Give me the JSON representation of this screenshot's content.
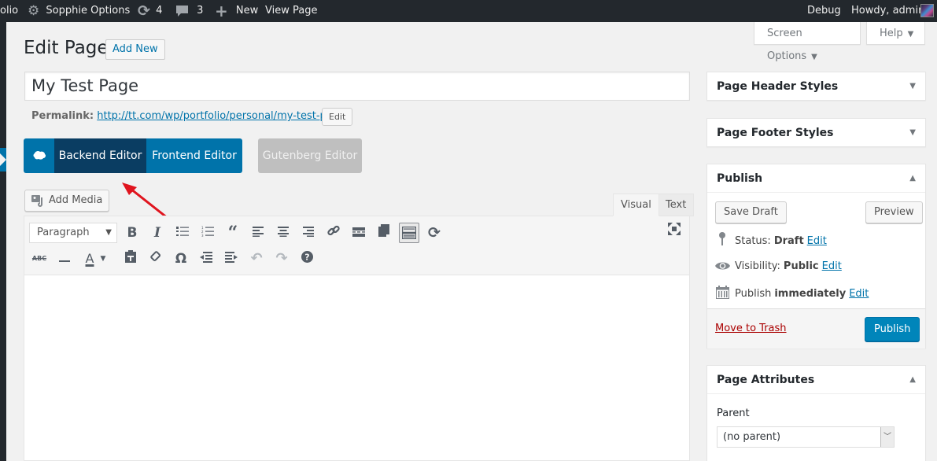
{
  "admin_bar": {
    "site_name_partial": "olio",
    "options_label": "Sopphie Options",
    "updates_count": "4",
    "comments_count": "3",
    "new_label": "New",
    "view_page_label": "View Page",
    "debug_label": "Debug",
    "greeting": "Howdy, admin"
  },
  "screen_meta": {
    "screen_options_label": "Screen Options",
    "help_label": "Help"
  },
  "header": {
    "title": "Edit Page",
    "add_new_label": "Add New"
  },
  "post": {
    "title_value": "My Test Page",
    "permalink_label": "Permalink:",
    "permalink_base": "http://tt.com/wp/portfolio/personal/",
    "permalink_slug": "my-test-page",
    "permalink_trailing": "/",
    "permalink_edit_label": "Edit"
  },
  "editor_switch": {
    "backend_label": "Backend Editor",
    "frontend_label": "Frontend Editor",
    "gutenberg_label": "Gutenberg Editor",
    "active": "Backend Editor"
  },
  "editor": {
    "add_media_label": "Add Media",
    "tabs": [
      {
        "label": "Visual",
        "active": true
      },
      {
        "label": "Text",
        "active": false
      }
    ],
    "format_select_value": "Paragraph",
    "toolbar_row1": [
      "bold",
      "italic",
      "bulleted-list",
      "numbered-list",
      "blockquote",
      "align-left",
      "align-center",
      "align-right",
      "insert-link",
      "read-more",
      "page-break",
      "toolbar-toggle",
      "refresh",
      "fullscreen"
    ],
    "toolbar_row2": [
      "strikethrough",
      "horizontal-line",
      "text-color",
      "paste-as-text",
      "clear-formatting",
      "special-character",
      "decrease-indent",
      "increase-indent",
      "undo",
      "redo",
      "keyboard-shortcuts"
    ],
    "content": ""
  },
  "sidebar": {
    "page_header_styles": {
      "title": "Page Header Styles",
      "collapsed": true
    },
    "page_footer_styles": {
      "title": "Page Footer Styles",
      "collapsed": true
    },
    "publish": {
      "title": "Publish",
      "save_draft_label": "Save Draft",
      "preview_label": "Preview",
      "status_label": "Status:",
      "status_value": "Draft",
      "visibility_label": "Visibility:",
      "visibility_value": "Public",
      "publish_label": "Publish",
      "publish_value": "immediately",
      "edit_label": "Edit",
      "trash_label": "Move to Trash",
      "publish_button_label": "Publish"
    },
    "page_attributes": {
      "title": "Page Attributes",
      "parent_label": "Parent",
      "parent_value": "(no parent)"
    }
  },
  "colors": {
    "admin_bar_bg": "#23282d",
    "primary_blue": "#0073aa",
    "backend_active": "#0a3d62",
    "gutenberg_disabled": "#bfbfbf",
    "trash_red": "#a00000",
    "annotation_red": "#e0141e"
  }
}
